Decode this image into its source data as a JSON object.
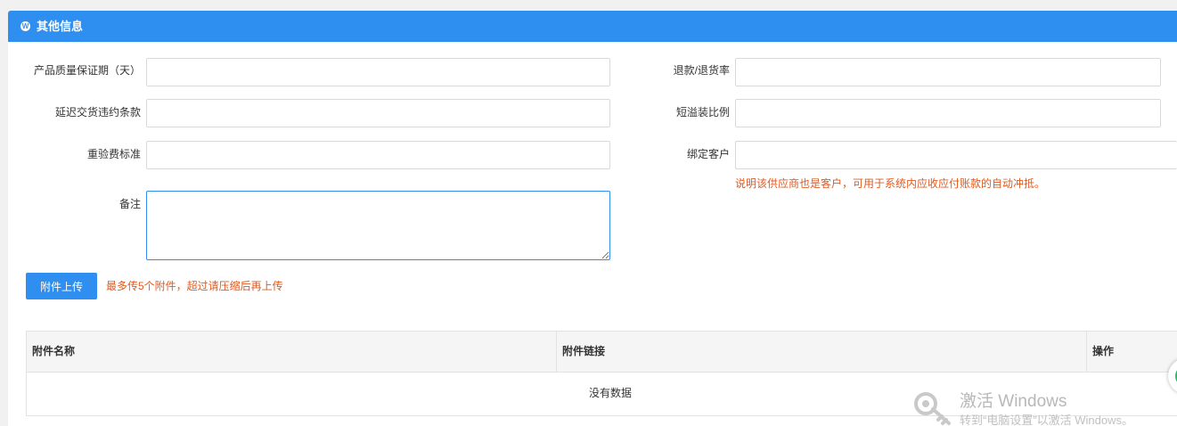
{
  "panel": {
    "title": "其他信息",
    "icon": "wordpress-icon",
    "accent_color": "#2e8ff0"
  },
  "form": {
    "warranty_label": "产品质量保证期（天）",
    "warranty_value": "",
    "refund_rate_label": "退款/退货率",
    "refund_rate_value": "",
    "delay_penalty_label": "延迟交货违约条款",
    "delay_penalty_value": "",
    "short_over_ratio_label": "短溢装比例",
    "short_over_ratio_value": "",
    "reinspection_fee_label": "重验费标准",
    "reinspection_fee_value": "",
    "bind_customer_label": "绑定客户",
    "bind_customer_value": "",
    "bind_customer_hint": "说明该供应商也是客户，可用于系统内应收应付账款的自动冲抵。",
    "remark_label": "备注",
    "remark_value": ""
  },
  "attachments": {
    "upload_label": "附件上传",
    "upload_hint": "最多传5个附件，超过请压缩后再上传",
    "columns": [
      "附件名称",
      "附件链接",
      "操作"
    ],
    "empty_text": "没有数据",
    "rows": []
  },
  "watermark": {
    "title": "激活 Windows",
    "subtitle": "转到“电脑设置”以激活 Windows。"
  },
  "colors": {
    "primary": "#2e8ff0",
    "hint": "#e05a20",
    "border": "#d9d9d9"
  }
}
